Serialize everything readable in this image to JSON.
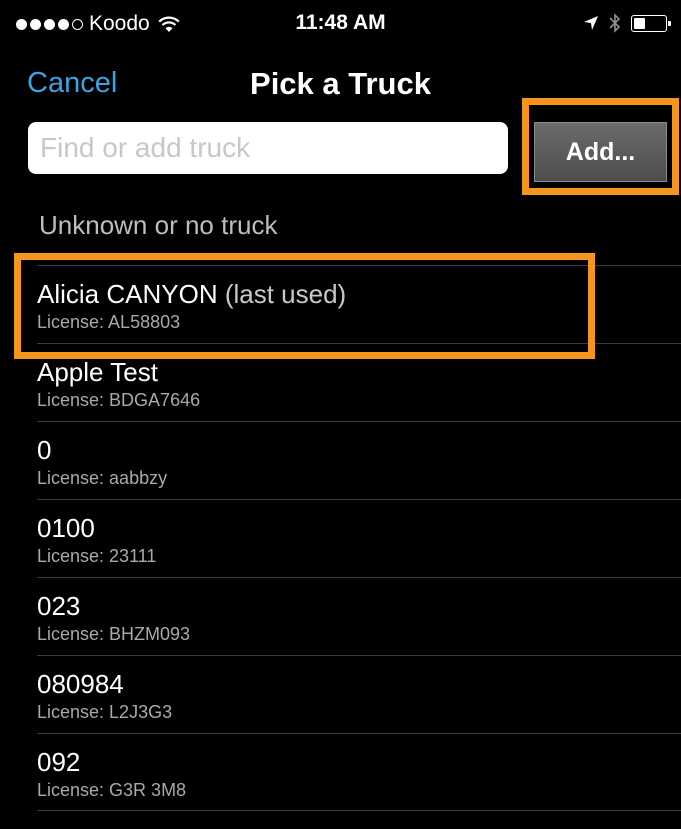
{
  "status_bar": {
    "carrier": "Koodo",
    "time": "11:48 AM",
    "signal_bars_filled": 4,
    "signal_bars_total": 5,
    "battery_level": 0.35
  },
  "nav": {
    "cancel_label": "Cancel",
    "title": "Pick a Truck"
  },
  "search": {
    "placeholder": "Find or add truck",
    "value": ""
  },
  "add_button_label": "Add...",
  "unknown_label": "Unknown or no truck",
  "trucks": [
    {
      "name": "Alicia CANYON",
      "note": "(last used)",
      "license": "License: AL58803"
    },
    {
      "name": "Apple Test",
      "note": "",
      "license": "License: BDGA7646"
    },
    {
      "name": "0",
      "note": "",
      "license": "License: aabbzy"
    },
    {
      "name": "0100",
      "note": "",
      "license": "License: 23111"
    },
    {
      "name": "023",
      "note": "",
      "license": "License: BHZM093"
    },
    {
      "name": "080984",
      "note": "",
      "license": "License: L2J3G3"
    },
    {
      "name": "092",
      "note": "",
      "license": "License: G3R 3M8"
    }
  ],
  "colors": {
    "accent": "#3aa3e3",
    "highlight": "#f7941d",
    "background": "#000000"
  },
  "icons": {
    "wifi": "wifi-icon",
    "location": "location-arrow-icon",
    "bluetooth": "bluetooth-icon",
    "battery": "battery-icon"
  }
}
